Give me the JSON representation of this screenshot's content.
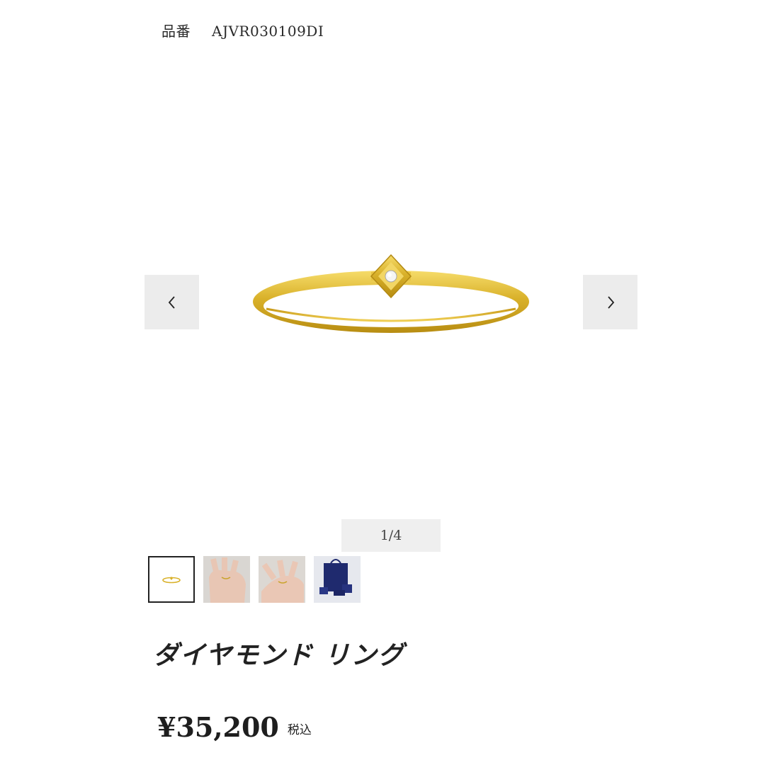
{
  "product": {
    "sku_label": "品番",
    "sku_value": "AJVR030109DI",
    "name": "ダイヤモンド リング",
    "price": "¥35,200",
    "tax_note": "税込"
  },
  "gallery": {
    "counter": "1/4",
    "prev_icon": "chevron-left-icon",
    "next_icon": "chevron-right-icon",
    "accent_gold": "#d9b12a",
    "button_bg": "#ececec"
  },
  "thumbnails": [
    {
      "name": "ring-product"
    },
    {
      "name": "ring-on-hand-1"
    },
    {
      "name": "ring-on-hand-2"
    },
    {
      "name": "gift-packaging"
    }
  ]
}
